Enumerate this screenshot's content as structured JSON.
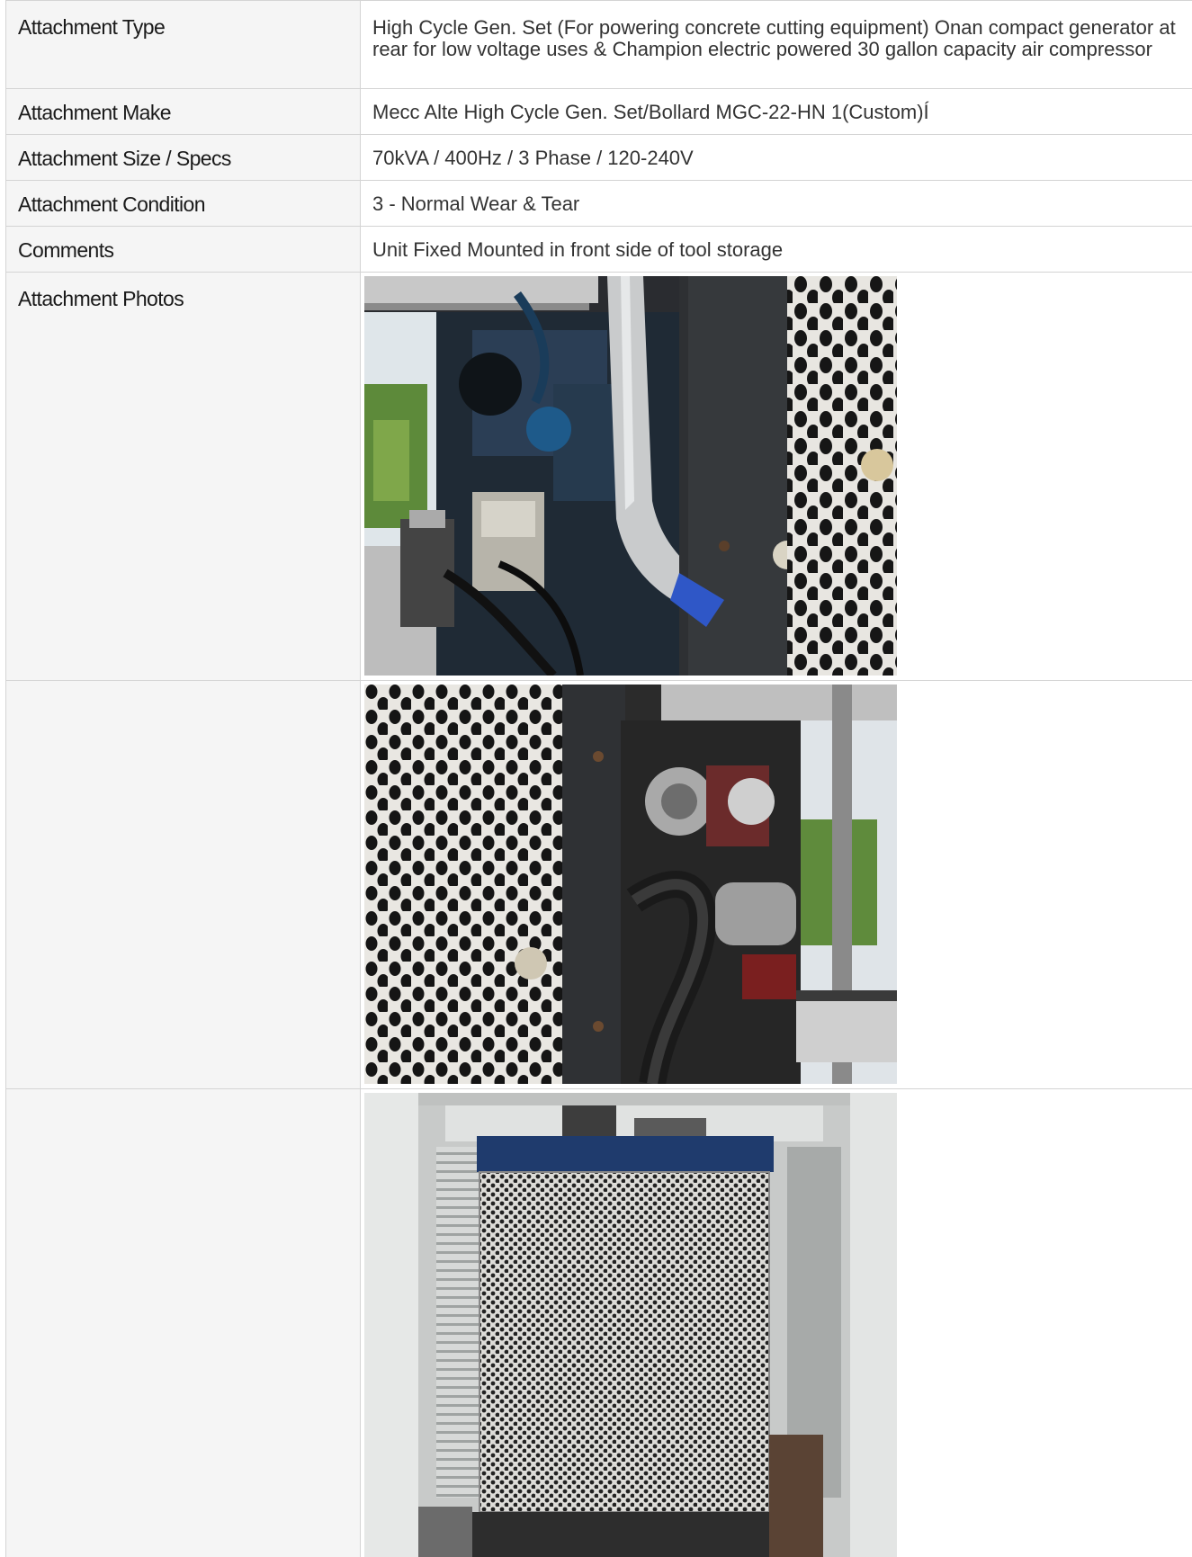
{
  "rows": [
    {
      "label": "Attachment Type",
      "value": "High Cycle Gen. Set (For powering concrete cutting equipment) Onan compact generator at rear for low voltage uses & Champion electric powered 30 gallon capacity air compressor"
    },
    {
      "label": "Attachment Make",
      "value": "Mecc Alte High Cycle Gen. Set/Bollard MGC-22-HN 1(Custom)Í"
    },
    {
      "label": "Attachment Size / Specs",
      "value": "70kVA / 400Hz / 3 Phase / 120-240V"
    },
    {
      "label": "Attachment Condition",
      "value": "3 - Normal Wear & Tear"
    },
    {
      "label": "Comments",
      "value": "Unit Fixed Mounted in front side of tool storage"
    }
  ],
  "photos_label": "Attachment Photos",
  "photos": [
    {
      "subject": "engine-bay-side-view"
    },
    {
      "subject": "perforated-panel-and-engine"
    },
    {
      "subject": "radiator-grille-in-enclosure"
    }
  ]
}
